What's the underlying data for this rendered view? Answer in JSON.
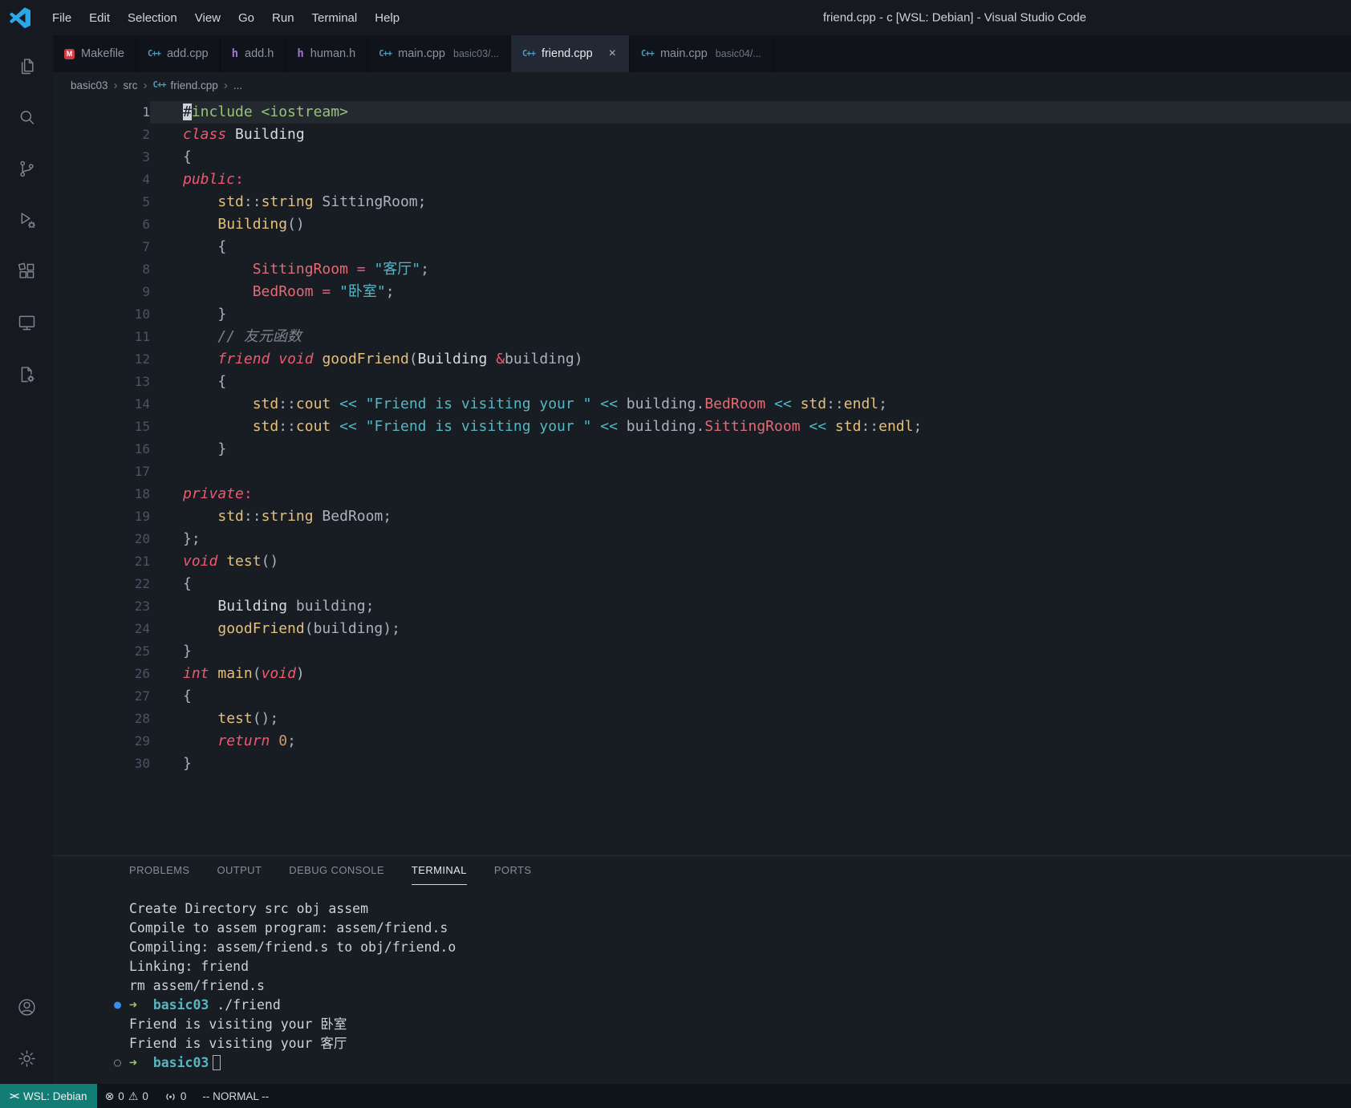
{
  "colors": {
    "brand_blue": "#2ba7e8",
    "keyword": "#ef596f",
    "function": "#e5c07b",
    "type": "#e5c07b",
    "classname": "#d7dae0",
    "property": "#e06c75",
    "string": "#56b6c2",
    "operator": "#56b6c2",
    "include": "#98c379",
    "comment": "#7f848e",
    "plain": "#abb2bf",
    "number": "#d19a66",
    "lineno": "#4b5364",
    "lineno_active": "#9aa6b8",
    "term_text": "#ccd2da",
    "prompt_arrow": "#98c379",
    "prompt_dir": "#56b6c2",
    "decoration_blue": "#3b8eea",
    "cpp_icon": "#519aba",
    "h_icon": "#a074c4",
    "makefile_icon": "#cc3e44",
    "remote_bg": "#117d74"
  },
  "titlebar": {
    "menus": [
      "File",
      "Edit",
      "Selection",
      "View",
      "Go",
      "Run",
      "Terminal",
      "Help"
    ],
    "title": "friend.cpp - c [WSL: Debian] - Visual Studio Code"
  },
  "activitybar": {
    "top": [
      {
        "name": "explorer"
      },
      {
        "name": "search"
      },
      {
        "name": "source-control"
      },
      {
        "name": "run-debug"
      },
      {
        "name": "extensions"
      },
      {
        "name": "remote-explorer"
      },
      {
        "name": "tools"
      }
    ],
    "bottom": [
      {
        "name": "account"
      },
      {
        "name": "settings"
      }
    ]
  },
  "tabs": [
    {
      "label": "Makefile",
      "icon": "makefile"
    },
    {
      "label": "add.cpp",
      "icon": "cpp"
    },
    {
      "label": "add.h",
      "icon": "h"
    },
    {
      "label": "human.h",
      "icon": "h"
    },
    {
      "label": "main.cpp",
      "desc": "basic03/...",
      "icon": "cpp"
    },
    {
      "label": "friend.cpp",
      "icon": "cpp",
      "active": true,
      "close": "×"
    },
    {
      "label": "main.cpp",
      "desc": "basic04/...",
      "icon": "cpp"
    }
  ],
  "breadcrumb": {
    "items": [
      {
        "label": "basic03"
      },
      {
        "label": "src"
      },
      {
        "label": "friend.cpp",
        "icon": "cpp"
      },
      {
        "label": "..."
      }
    ]
  },
  "editor": {
    "lines": [
      {
        "n": 1,
        "active": true,
        "tokens": [
          {
            "t": "#",
            "c": "include",
            "cursor": true
          },
          {
            "t": "include",
            "c": "include"
          },
          {
            "t": " ",
            "c": "plain"
          },
          {
            "t": "<iostream>",
            "c": "include"
          }
        ]
      },
      {
        "n": 2,
        "tokens": [
          {
            "t": "class",
            "c": "keyword",
            "i": true
          },
          {
            "t": " ",
            "c": "plain"
          },
          {
            "t": "Building",
            "c": "classname"
          }
        ]
      },
      {
        "n": 3,
        "tokens": [
          {
            "t": "{",
            "c": "plain"
          }
        ]
      },
      {
        "n": 4,
        "tokens": [
          {
            "t": "public",
            "c": "keyword",
            "i": true
          },
          {
            "t": ":",
            "c": "keyword"
          }
        ]
      },
      {
        "n": 5,
        "tokens": [
          {
            "t": "    ",
            "c": "plain"
          },
          {
            "t": "std",
            "c": "type"
          },
          {
            "t": "::",
            "c": "plain"
          },
          {
            "t": "string",
            "c": "type"
          },
          {
            "t": " SittingRoom;",
            "c": "plain"
          }
        ]
      },
      {
        "n": 6,
        "tokens": [
          {
            "t": "    ",
            "c": "plain"
          },
          {
            "t": "Building",
            "c": "function"
          },
          {
            "t": "()",
            "c": "plain"
          }
        ]
      },
      {
        "n": 7,
        "tokens": [
          {
            "t": "    {",
            "c": "plain"
          }
        ]
      },
      {
        "n": 8,
        "tokens": [
          {
            "t": "        ",
            "c": "plain"
          },
          {
            "t": "SittingRoom",
            "c": "property"
          },
          {
            "t": " ",
            "c": "plain"
          },
          {
            "t": "=",
            "c": "keyword"
          },
          {
            "t": " ",
            "c": "plain"
          },
          {
            "t": "\"客厅\"",
            "c": "string"
          },
          {
            "t": ";",
            "c": "plain"
          }
        ]
      },
      {
        "n": 9,
        "tokens": [
          {
            "t": "        ",
            "c": "plain"
          },
          {
            "t": "BedRoom",
            "c": "property"
          },
          {
            "t": " ",
            "c": "plain"
          },
          {
            "t": "=",
            "c": "keyword"
          },
          {
            "t": " ",
            "c": "plain"
          },
          {
            "t": "\"卧室\"",
            "c": "string"
          },
          {
            "t": ";",
            "c": "plain"
          }
        ]
      },
      {
        "n": 10,
        "tokens": [
          {
            "t": "    }",
            "c": "plain"
          }
        ]
      },
      {
        "n": 11,
        "tokens": [
          {
            "t": "    ",
            "c": "plain"
          },
          {
            "t": "// 友元函数",
            "c": "comment",
            "i": true
          }
        ]
      },
      {
        "n": 12,
        "tokens": [
          {
            "t": "    ",
            "c": "plain"
          },
          {
            "t": "friend",
            "c": "keyword",
            "i": true
          },
          {
            "t": " ",
            "c": "plain"
          },
          {
            "t": "void",
            "c": "keyword",
            "i": true
          },
          {
            "t": " ",
            "c": "plain"
          },
          {
            "t": "goodFriend",
            "c": "function"
          },
          {
            "t": "(",
            "c": "plain"
          },
          {
            "t": "Building",
            "c": "classname"
          },
          {
            "t": " ",
            "c": "plain"
          },
          {
            "t": "&",
            "c": "keyword"
          },
          {
            "t": "building",
            "c": "plain"
          },
          {
            "t": ")",
            "c": "plain"
          }
        ]
      },
      {
        "n": 13,
        "tokens": [
          {
            "t": "    {",
            "c": "plain"
          }
        ]
      },
      {
        "n": 14,
        "tokens": [
          {
            "t": "        ",
            "c": "plain"
          },
          {
            "t": "std",
            "c": "type"
          },
          {
            "t": "::",
            "c": "plain"
          },
          {
            "t": "cout",
            "c": "type"
          },
          {
            "t": " ",
            "c": "plain"
          },
          {
            "t": "<<",
            "c": "operator"
          },
          {
            "t": " ",
            "c": "plain"
          },
          {
            "t": "\"Friend is visiting your \"",
            "c": "string"
          },
          {
            "t": " ",
            "c": "plain"
          },
          {
            "t": "<<",
            "c": "operator"
          },
          {
            "t": " ",
            "c": "plain"
          },
          {
            "t": "building",
            "c": "plain"
          },
          {
            "t": ".",
            "c": "plain"
          },
          {
            "t": "BedRoom",
            "c": "property"
          },
          {
            "t": " ",
            "c": "plain"
          },
          {
            "t": "<<",
            "c": "operator"
          },
          {
            "t": " ",
            "c": "plain"
          },
          {
            "t": "std",
            "c": "type"
          },
          {
            "t": "::",
            "c": "plain"
          },
          {
            "t": "endl",
            "c": "type"
          },
          {
            "t": ";",
            "c": "plain"
          }
        ]
      },
      {
        "n": 15,
        "tokens": [
          {
            "t": "        ",
            "c": "plain"
          },
          {
            "t": "std",
            "c": "type"
          },
          {
            "t": "::",
            "c": "plain"
          },
          {
            "t": "cout",
            "c": "type"
          },
          {
            "t": " ",
            "c": "plain"
          },
          {
            "t": "<<",
            "c": "operator"
          },
          {
            "t": " ",
            "c": "plain"
          },
          {
            "t": "\"Friend is visiting your \"",
            "c": "string"
          },
          {
            "t": " ",
            "c": "plain"
          },
          {
            "t": "<<",
            "c": "operator"
          },
          {
            "t": " ",
            "c": "plain"
          },
          {
            "t": "building",
            "c": "plain"
          },
          {
            "t": ".",
            "c": "plain"
          },
          {
            "t": "SittingRoom",
            "c": "property"
          },
          {
            "t": " ",
            "c": "plain"
          },
          {
            "t": "<<",
            "c": "operator"
          },
          {
            "t": " ",
            "c": "plain"
          },
          {
            "t": "std",
            "c": "type"
          },
          {
            "t": "::",
            "c": "plain"
          },
          {
            "t": "endl",
            "c": "type"
          },
          {
            "t": ";",
            "c": "plain"
          }
        ]
      },
      {
        "n": 16,
        "tokens": [
          {
            "t": "    }",
            "c": "plain"
          }
        ]
      },
      {
        "n": 17,
        "tokens": []
      },
      {
        "n": 18,
        "tokens": [
          {
            "t": "private",
            "c": "keyword",
            "i": true
          },
          {
            "t": ":",
            "c": "keyword"
          }
        ]
      },
      {
        "n": 19,
        "tokens": [
          {
            "t": "    ",
            "c": "plain"
          },
          {
            "t": "std",
            "c": "type"
          },
          {
            "t": "::",
            "c": "plain"
          },
          {
            "t": "string",
            "c": "type"
          },
          {
            "t": " BedRoom;",
            "c": "plain"
          }
        ]
      },
      {
        "n": 20,
        "tokens": [
          {
            "t": "};",
            "c": "plain"
          }
        ]
      },
      {
        "n": 21,
        "tokens": [
          {
            "t": "void",
            "c": "keyword",
            "i": true
          },
          {
            "t": " ",
            "c": "plain"
          },
          {
            "t": "test",
            "c": "function"
          },
          {
            "t": "()",
            "c": "plain"
          }
        ]
      },
      {
        "n": 22,
        "tokens": [
          {
            "t": "{",
            "c": "plain"
          }
        ]
      },
      {
        "n": 23,
        "tokens": [
          {
            "t": "    ",
            "c": "plain"
          },
          {
            "t": "Building",
            "c": "classname"
          },
          {
            "t": " building;",
            "c": "plain"
          }
        ]
      },
      {
        "n": 24,
        "tokens": [
          {
            "t": "    ",
            "c": "plain"
          },
          {
            "t": "goodFriend",
            "c": "function"
          },
          {
            "t": "(",
            "c": "plain"
          },
          {
            "t": "building",
            "c": "plain"
          },
          {
            "t": ");",
            "c": "plain"
          }
        ]
      },
      {
        "n": 25,
        "tokens": [
          {
            "t": "}",
            "c": "plain"
          }
        ]
      },
      {
        "n": 26,
        "tokens": [
          {
            "t": "int",
            "c": "keyword",
            "i": true
          },
          {
            "t": " ",
            "c": "plain"
          },
          {
            "t": "main",
            "c": "function"
          },
          {
            "t": "(",
            "c": "plain"
          },
          {
            "t": "void",
            "c": "keyword",
            "i": true
          },
          {
            "t": ")",
            "c": "plain"
          }
        ]
      },
      {
        "n": 27,
        "tokens": [
          {
            "t": "{",
            "c": "plain"
          }
        ]
      },
      {
        "n": 28,
        "tokens": [
          {
            "t": "    ",
            "c": "plain"
          },
          {
            "t": "test",
            "c": "function"
          },
          {
            "t": "();",
            "c": "plain"
          }
        ]
      },
      {
        "n": 29,
        "tokens": [
          {
            "t": "    ",
            "c": "plain"
          },
          {
            "t": "return",
            "c": "keyword",
            "i": true
          },
          {
            "t": " ",
            "c": "plain"
          },
          {
            "t": "0",
            "c": "number"
          },
          {
            "t": ";",
            "c": "plain"
          }
        ]
      },
      {
        "n": 30,
        "tokens": [
          {
            "t": "}",
            "c": "plain"
          }
        ]
      }
    ]
  },
  "panel": {
    "tabs": [
      "PROBLEMS",
      "OUTPUT",
      "DEBUG CONSOLE",
      "TERMINAL",
      "PORTS"
    ],
    "active": "TERMINAL"
  },
  "terminal": {
    "lines": [
      {
        "tokens": [
          {
            "t": "Create Directory src obj assem",
            "c": "term_text"
          }
        ]
      },
      {
        "tokens": [
          {
            "t": "Compile to assem program: assem/friend.s",
            "c": "term_text"
          }
        ]
      },
      {
        "tokens": [
          {
            "t": "Compiling: assem/friend.s to obj/friend.o",
            "c": "term_text"
          }
        ]
      },
      {
        "tokens": [
          {
            "t": "Linking: friend",
            "c": "term_text"
          }
        ]
      },
      {
        "tokens": [
          {
            "t": "rm assem/friend.s",
            "c": "term_text"
          }
        ]
      },
      {
        "decoration": "filled",
        "tokens": [
          {
            "t": "➜",
            "c": "prompt_arrow",
            "b": true
          },
          {
            "t": "  ",
            "c": "term_text"
          },
          {
            "t": "basic03",
            "c": "prompt_dir",
            "b": true
          },
          {
            "t": " ./friend",
            "c": "term_text"
          }
        ]
      },
      {
        "tokens": [
          {
            "t": "Friend is visiting your 卧室",
            "c": "term_text"
          }
        ]
      },
      {
        "tokens": [
          {
            "t": "Friend is visiting your 客厅",
            "c": "term_text"
          }
        ]
      },
      {
        "decoration": "hollow",
        "cursor": true,
        "tokens": [
          {
            "t": "➜",
            "c": "prompt_arrow",
            "b": true
          },
          {
            "t": "  ",
            "c": "term_text"
          },
          {
            "t": "basic03",
            "c": "prompt_dir",
            "b": true
          }
        ]
      }
    ]
  },
  "statusbar": {
    "remote_label": "WSL: Debian",
    "errors": "0",
    "warnings": "0",
    "ports": "0",
    "mode": "-- NORMAL --"
  }
}
